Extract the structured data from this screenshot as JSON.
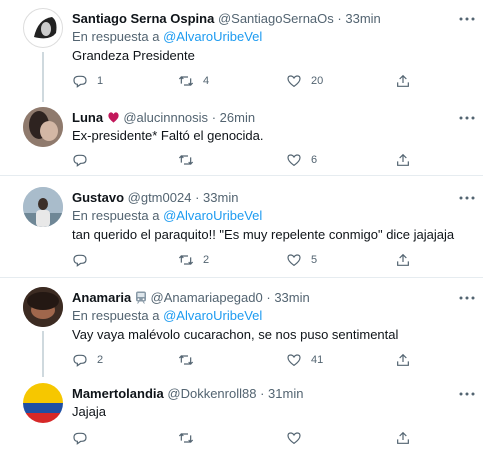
{
  "tweets": [
    {
      "name": "Santiago Serna Ospina",
      "handle": "@SantiagoSernaOs",
      "time": "33min",
      "reply_prefix": "En respuesta a",
      "reply_to": "@AlvaroUribeVel",
      "text": "Grandeza Presidente",
      "counts": {
        "reply": "1",
        "retweet": "4",
        "like": "20"
      }
    },
    {
      "name": "Luna",
      "handle": "@alucinnnosis",
      "time": "26min",
      "text": "Ex-presidente* Faltó el genocida.",
      "counts": {
        "reply": "",
        "retweet": "",
        "like": "6"
      }
    },
    {
      "name": "Gustavo",
      "handle": "@gtm0024",
      "time": "33min",
      "reply_prefix": "En respuesta a",
      "reply_to": "@AlvaroUribeVel",
      "text": "tan querido el paraquito!! \"Es muy repelente conmigo\" dice jajajaja",
      "counts": {
        "reply": "",
        "retweet": "2",
        "like": "5"
      }
    },
    {
      "name": "Anamaria",
      "handle": "@Anamariapegad0",
      "time": "33min",
      "reply_prefix": "En respuesta a",
      "reply_to": "@AlvaroUribeVel",
      "text": "Vay vaya malévolo cucarachon, se nos puso sentimental",
      "counts": {
        "reply": "2",
        "retweet": "",
        "like": "41"
      }
    },
    {
      "name": "Mamertolandia",
      "handle": "@Dokkenroll88",
      "time": "31min",
      "text": "Jajaja",
      "counts": {
        "reply": "",
        "retweet": "",
        "like": ""
      }
    }
  ],
  "separator": "·",
  "colors": {
    "accent": "#1d9bf0",
    "muted": "#536471",
    "text": "#0f1419",
    "border": "#e6ecf0",
    "heart_emoji": "#c2185b"
  },
  "icons": {
    "reply": "reply-icon",
    "retweet": "retweet-icon",
    "like": "heart-icon",
    "share": "share-icon",
    "more": "more-icon"
  }
}
